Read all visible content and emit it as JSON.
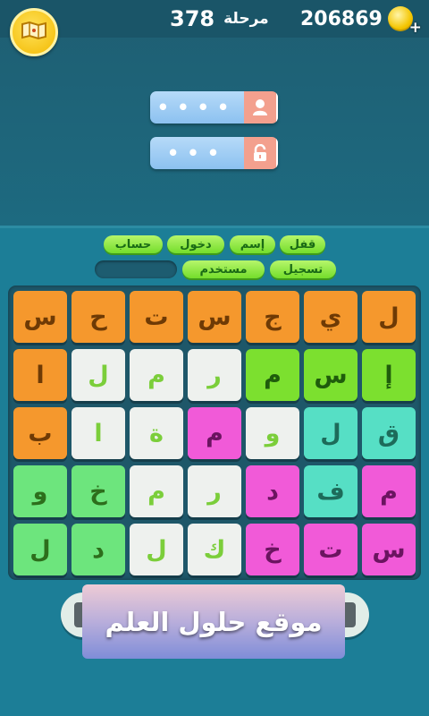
{
  "header": {
    "coins": "206869",
    "coin_plus": "+",
    "level_label": "مرحلة",
    "level_number": "378"
  },
  "answers": [
    {
      "icon": "person-icon",
      "dots": "••••"
    },
    {
      "icon": "padlock-icon",
      "dots": "•••"
    }
  ],
  "hint_words": [
    {
      "text": "قفل"
    },
    {
      "text": "إسم"
    },
    {
      "text": "دخول"
    },
    {
      "text": "حساب"
    },
    {
      "text": "تسجيل"
    },
    {
      "text": "مستخدم"
    },
    {
      "text": ""
    }
  ],
  "board": {
    "rows": [
      [
        "ل",
        "ي",
        "ج",
        "س",
        "ت",
        "ح",
        "س"
      ],
      [
        "إ",
        "س",
        "م",
        "ر",
        "م",
        "ل",
        "ا"
      ],
      [
        "ق",
        "ل",
        "و",
        "م",
        "ة",
        "ا",
        "ب"
      ],
      [
        "م",
        "ف",
        "د",
        "ر",
        "م",
        "خ",
        "و"
      ],
      [
        "س",
        "ت",
        "خ",
        "ك",
        "ل",
        "د",
        "ل"
      ]
    ],
    "colors": {
      "orange": "#f5982d",
      "green": "#7ce02f",
      "white": "#eef1ee",
      "teal": "#56dfc5",
      "pink": "#f15ad8",
      "mint": "#6de57d"
    },
    "color_rows": [
      [
        "orange",
        "orange",
        "orange",
        "orange",
        "orange",
        "orange",
        "orange"
      ],
      [
        "green",
        "green",
        "green",
        "white",
        "white",
        "white",
        "orange"
      ],
      [
        "teal",
        "teal",
        "white",
        "pink",
        "white",
        "white",
        "orange"
      ],
      [
        "pink",
        "teal",
        "pink",
        "white",
        "white",
        "mint",
        "mint"
      ],
      [
        "pink",
        "pink",
        "pink",
        "white",
        "white",
        "mint",
        "mint"
      ]
    ]
  },
  "watermark": "موقع حلول العلم"
}
